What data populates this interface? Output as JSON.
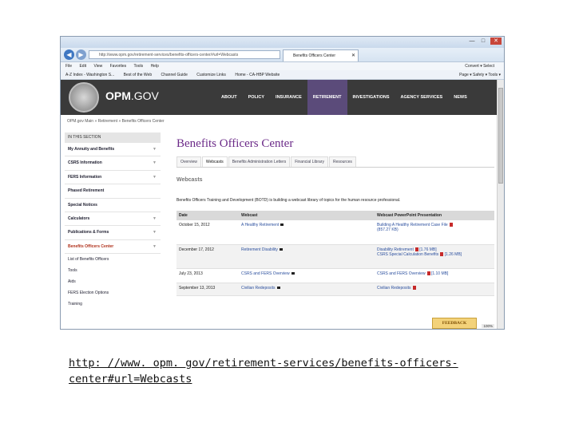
{
  "browser": {
    "address": "http://www.opm.gov/retirement-services/benefits-officers-center/#url=Webcasts",
    "tab_title": "Benefits Officers Center",
    "menu": [
      "File",
      "Edit",
      "View",
      "Favorites",
      "Tools",
      "Help"
    ],
    "menu_right": "Convert  ▾  Select",
    "favorites": [
      "A-Z Index - Washington S...",
      "Best of the Web",
      "Channel Guide",
      "Customize Links",
      "Home - CA-HBP Website"
    ],
    "toolbar_right": "Page ▾  Safety ▾  Tools ▾",
    "zoom": "100%"
  },
  "site": {
    "logo_main": "OPM",
    "logo_suffix": ".GOV",
    "nav": [
      "ABOUT",
      "POLICY",
      "INSURANCE",
      "RETIREMENT",
      "INVESTIGATIONS",
      "AGENCY SERVICES",
      "NEWS"
    ],
    "breadcrumb": "OPM.gov Main  »  Retirement  »  Benefits Officers Center"
  },
  "sidebar": {
    "heading": "IN THIS SECTION",
    "items": [
      "My Annuity and Benefits",
      "CSRS Information",
      "FERS Information",
      "Phased Retirement",
      "Special Notices",
      "Calculators",
      "Publications & Forms",
      "Benefits Officers Center"
    ],
    "subitems": [
      "List of Benefits Officers",
      "Tools",
      "Aids",
      "FERS Election Options",
      "Training"
    ]
  },
  "main": {
    "title": "Benefits Officers Center",
    "tabs": [
      "Overview",
      "Webcasts",
      "Benefits Administration Letters",
      "Financial Library",
      "Resources"
    ],
    "section_title": "Webcasts",
    "intro": "Benefits Officers Training and Development (BOTD) is building a webcast library of topics for the human resource professional.",
    "columns": [
      "Date",
      "Webcast",
      "Webcast PowerPoint Presentation"
    ],
    "rows": [
      {
        "date": "October 15, 2012",
        "webcast": "A Healthy Retirement",
        "ppt": "Building A Healthy Retirement Case File",
        "size": "(857.27 KB)"
      },
      {
        "date": "December 17, 2012",
        "webcast": "Retirement Disability",
        "ppt": "Disability Retirement",
        "size": "[1.76 MB]",
        "ppt2": "CSRS Special Calculation Benefits",
        "size2": "[1.26 MB]"
      },
      {
        "date": "July 23, 2013",
        "webcast": "CSRS and FERS Overview",
        "ppt": "CSRS and FERS Overview",
        "size": "[1.10 MB]"
      },
      {
        "date": "September 13, 2013",
        "webcast": "Civilian Redeposits",
        "ppt": "Civilian Redeposits",
        "size": ""
      }
    ],
    "feedback": "FEEDBACK"
  },
  "caption": {
    "line1": "http: //www. opm. gov/retirement-services/benefits-officers-",
    "line2": "center#url=Webcasts"
  }
}
